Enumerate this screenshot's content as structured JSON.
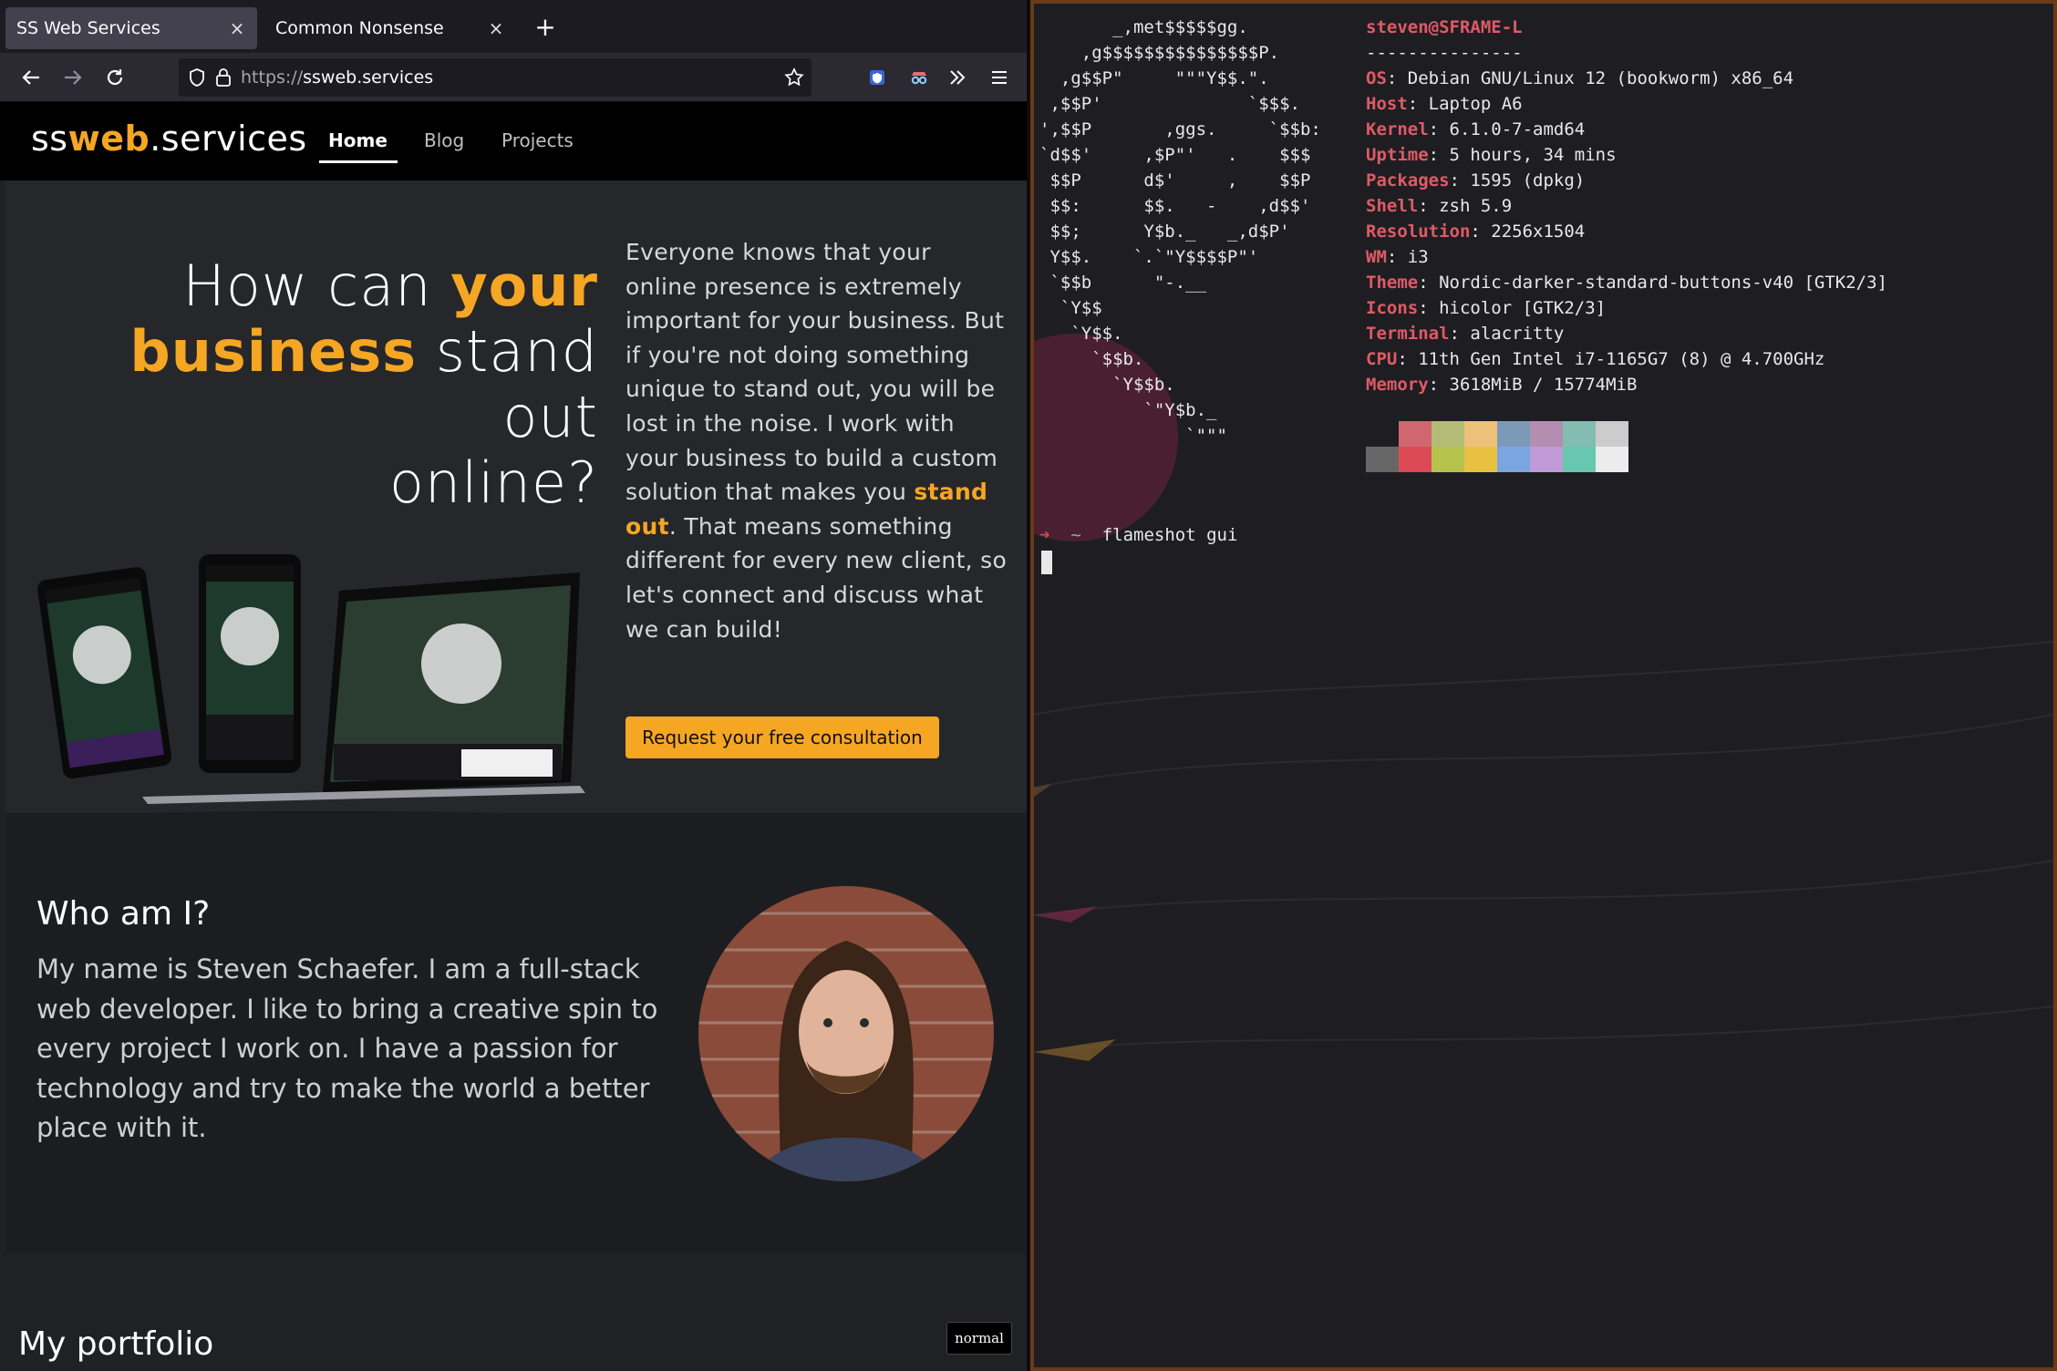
{
  "browser": {
    "tabs": [
      {
        "title": "SS Web Services",
        "active": true
      },
      {
        "title": "Common Nonsense",
        "active": false
      }
    ],
    "new_tab": "+",
    "close_glyph": "×",
    "url_scheme": "https://",
    "url_host": "ssweb.services"
  },
  "site": {
    "logo": {
      "pre": "ss",
      "accent": "web",
      "post": ".services"
    },
    "nav": [
      "Home",
      "Blog",
      "Projects"
    ],
    "hero": {
      "title_1": "How can ",
      "title_accent_1": "your",
      "title_accent_2": "business",
      "title_2": " stand out",
      "title_3": "online?",
      "copy_1": "Everyone knows that your online presence is extremely important for your business. But if you're not doing something unique to stand out, you will be lost in the noise. I work with your business to build a custom solution that makes you ",
      "copy_accent": "stand out",
      "copy_2": ". That means something different for every new client, so let's connect and discuss what we can build!",
      "cta": "Request your free consultation"
    },
    "about": {
      "title": "Who am I?",
      "copy": "My name is Steven Schaefer. I am a full-stack web developer. I like to bring a creative spin to every project I work on. I have a passion for technology and try to make the world a better place with it."
    },
    "portfolio": {
      "title": "My portfolio"
    }
  },
  "mode_badge": "normal",
  "terminal": {
    "ascii_art": [
      "       _,met$$$$$gg.",
      "    ,g$$$$$$$$$$$$$$$P.",
      "  ,g$$P\"     \"\"\"Y$$.\".",
      " ,$$P'              `$$$.",
      "',$$P       ,ggs.     `$$b:",
      "`d$$'     ,$P\"'   .    $$$",
      " $$P      d$'     ,    $$P",
      " $$:      $$.   -    ,d$$'",
      " $$;      Y$b._   _,d$P'",
      " Y$$.    `.`\"Y$$$$P\"'",
      " `$$b      \"-.__",
      "  `Y$$",
      "   `Y$$.",
      "     `$$b.",
      "       `Y$$b.",
      "          `\"Y$b._",
      "              `\"\"\""
    ],
    "user": "steven@SFRAME-L",
    "separator": "---------------",
    "info": [
      {
        "key": "OS",
        "value": "Debian GNU/Linux 12 (bookworm) x86_64"
      },
      {
        "key": "Host",
        "value": "Laptop A6"
      },
      {
        "key": "Kernel",
        "value": "6.1.0-7-amd64"
      },
      {
        "key": "Uptime",
        "value": "5 hours, 34 mins"
      },
      {
        "key": "Packages",
        "value": "1595 (dpkg)"
      },
      {
        "key": "Shell",
        "value": "zsh 5.9"
      },
      {
        "key": "Resolution",
        "value": "2256x1504"
      },
      {
        "key": "WM",
        "value": "i3"
      },
      {
        "key": "Theme",
        "value": "Nordic-darker-standard-buttons-v40 [GTK2/3]"
      },
      {
        "key": "Icons",
        "value": "hicolor [GTK2/3]"
      },
      {
        "key": "Terminal",
        "value": "alacritty"
      },
      {
        "key": "CPU",
        "value": "11th Gen Intel i7-1165G7 (8) @ 4.700GHz"
      },
      {
        "key": "Memory",
        "value": "3618MiB / 15774MiB"
      }
    ],
    "palette_top": [
      "#1e1e22",
      "#d0666f",
      "#b3bb76",
      "#eec17a",
      "#7d99b8",
      "#b48eb0",
      "#83bdb2",
      "#cccccc"
    ],
    "palette_bottom": [
      "#666666",
      "#dc4a55",
      "#b5c34d",
      "#e8c143",
      "#7aa5e0",
      "#c19ad8",
      "#68c7b0",
      "#ececec"
    ],
    "prompt_arrow": "➜",
    "prompt_dir": "~",
    "prompt_cmd": "flameshot gui"
  }
}
